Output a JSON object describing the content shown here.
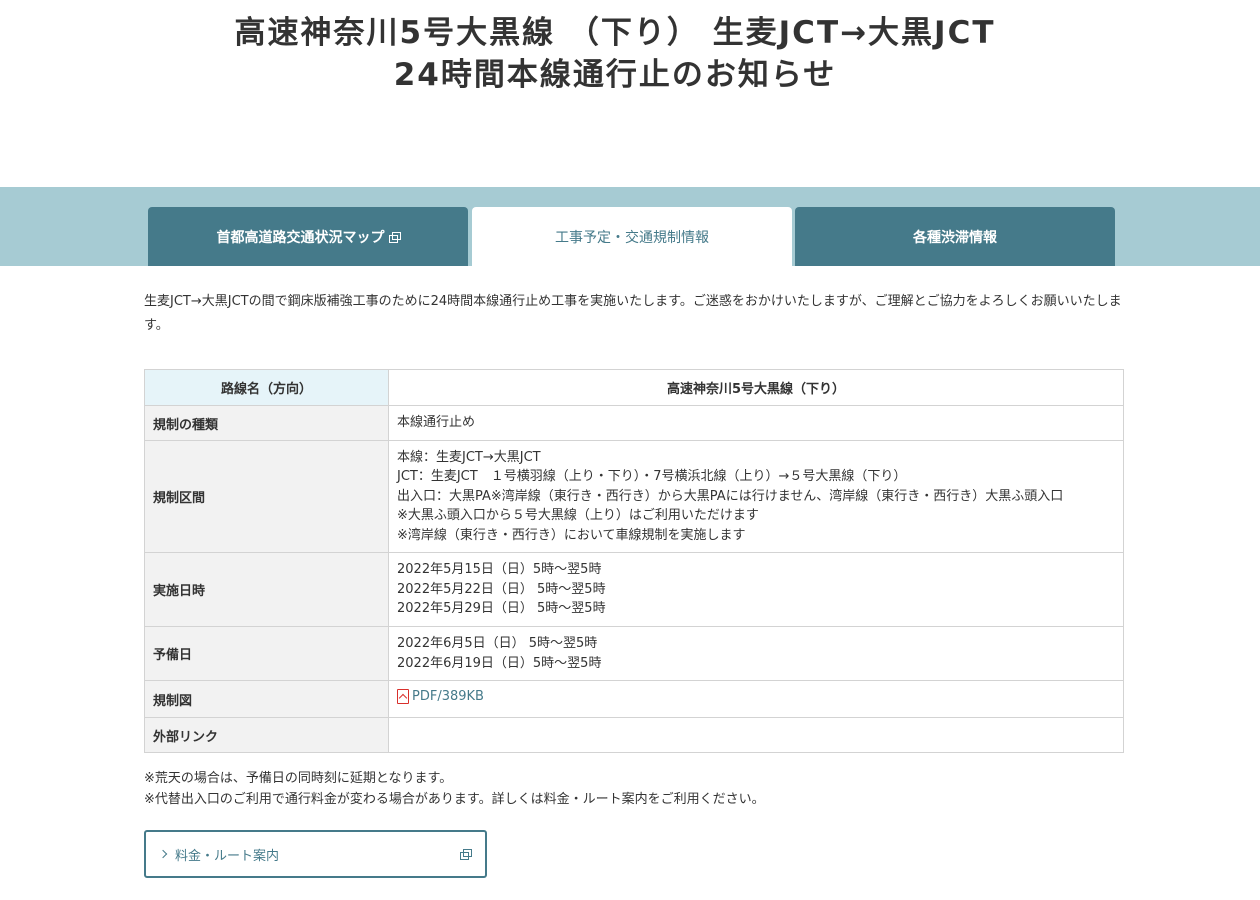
{
  "page": {
    "title_line1": "高速神奈川5号大黒線 （下り） 生麦JCT→大黒JCT",
    "title_line2": "24時間本線通行止のお知らせ"
  },
  "tabs": [
    {
      "label": "首都高道路交通状況マップ",
      "external": true
    },
    {
      "label": "工事予定・交通規制情報",
      "active": true
    },
    {
      "label": "各種渋滞情報"
    }
  ],
  "intro": "生麦JCT→大黒JCTの間で鋼床版補強工事のために24時間本線通行止め工事を実施いたします。ご迷惑をおかけいたしますが、ご理解とご協力をよろしくお願いいたします。",
  "table": {
    "header": {
      "label": "路線名（方向）",
      "value": "高速神奈川5号大黒線（下り）"
    },
    "rows": [
      {
        "label": "規制の種類",
        "lines": [
          "本線通行止め"
        ]
      },
      {
        "label": "規制区間",
        "lines": [
          "本線：生麦JCT→大黒JCT",
          "JCT：生麦JCT　１号横羽線（上り・下り）・7号横浜北線（上り）→５号大黒線（下り）",
          "出入口：大黒PA※湾岸線（東行き・西行き）から大黒PAには行けません、湾岸線（東行き・西行き）大黒ふ頭入口",
          "※大黒ふ頭入口から５号大黒線（上り）はご利用いただけます",
          "※湾岸線（東行き・西行き）において車線規制を実施します"
        ]
      },
      {
        "label": "実施日時",
        "lines": [
          "2022年5月15日（日）5時～翌5時",
          "2022年5月22日（日） 5時～翌5時",
          "2022年5月29日（日） 5時～翌5時"
        ]
      },
      {
        "label": "予備日",
        "lines": [
          "2022年6月5日（日） 5時～翌5時",
          "2022年6月19日（日）5時～翌5時"
        ]
      },
      {
        "label": "規制図",
        "link_text": "PDF/389KB"
      },
      {
        "label": "外部リンク",
        "lines": []
      }
    ]
  },
  "notes": [
    "※荒天の場合は、予備日の同時刻に延期となります。",
    "※代替出入口のご利用で通行料金が変わる場合があります。詳しくは料金・ルート案内をご利用ください。"
  ],
  "route_button": {
    "label": "料金・ルート案内"
  },
  "colors": {
    "accent": "#457a8a",
    "band": "#a6cbd3",
    "header_cell": "#e6f4f9",
    "label_cell": "#f2f2f2"
  }
}
